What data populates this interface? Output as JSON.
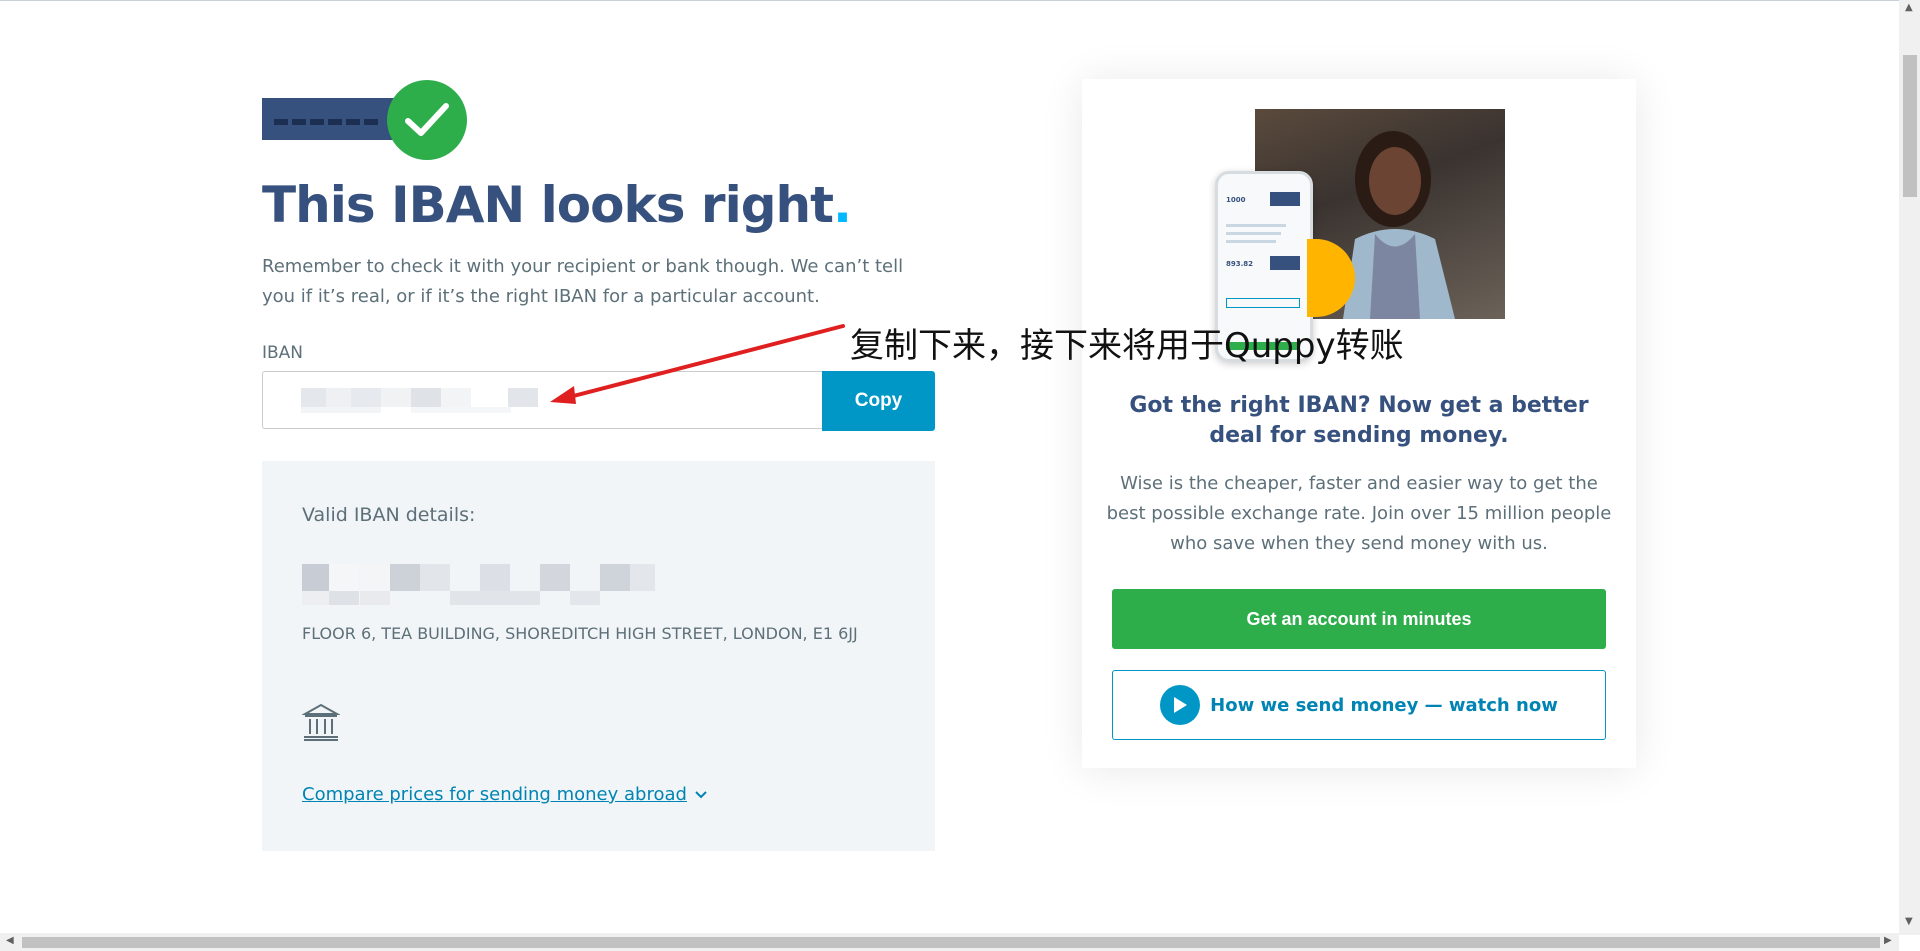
{
  "hero": {
    "icon": "check-icon"
  },
  "title": {
    "main": "This IBAN looks right",
    "dot": "."
  },
  "lede": "Remember to check it with your recipient or bank though. We can’t tell you if it’s real, or if it’s the right IBAN for a particular account.",
  "iban": {
    "label": "IBAN",
    "value": "",
    "copy_label": "Copy"
  },
  "details": {
    "title": "Valid IBAN details:",
    "address": "FLOOR 6, TEA BUILDING, SHOREDITCH HIGH STREET, LONDON, E1 6JJ",
    "bank_icon": "bank-icon",
    "compare_link": "Compare prices for sending money abroad",
    "compare_icon": "chevron-down-icon"
  },
  "promo": {
    "heading": "Got the right IBAN? Now get a better deal for sending money.",
    "body": "Wise is the cheaper, faster and easier way to get the best possible exchange rate. Join over 15 million people who save when they send money with us.",
    "primary_cta": "Get an account in minutes",
    "secondary_cta": "How we send money — watch now",
    "secondary_icon": "play-icon",
    "phone_amount_1": "1000",
    "phone_amount_2": "893.82"
  },
  "annotation": {
    "text": "复制下来，接下来将用于Quppy转账",
    "color": "#e02020"
  },
  "colors": {
    "navy": "#37517e",
    "blue": "#0097c7",
    "green": "#2ead4b",
    "accent_dot": "#00b9ff",
    "panel": "#f2f5f7"
  }
}
